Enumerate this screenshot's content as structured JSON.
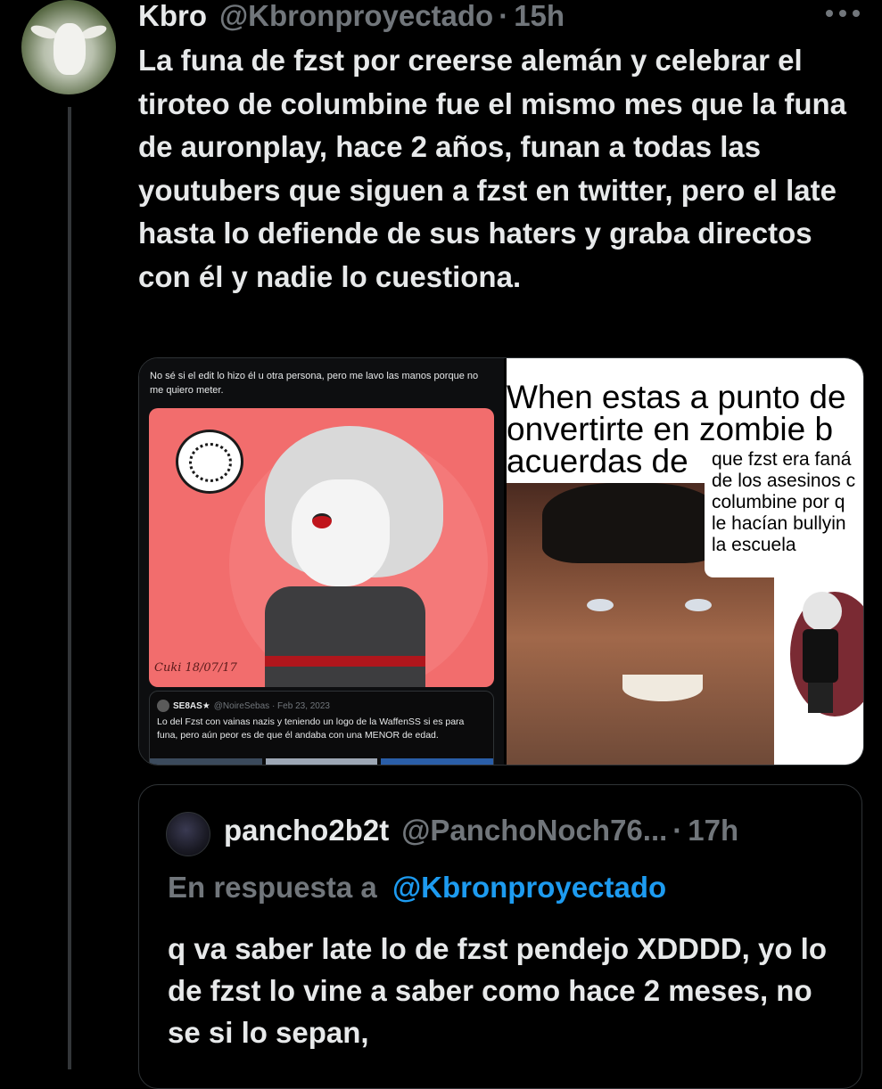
{
  "tweet": {
    "display_name": "Kbro",
    "handle": "@Kbronproyectado",
    "separator": "·",
    "time": "15h",
    "text": "La funa de fzst por creerse alemán y celebrar el tiroteo de columbine fue el mismo mes que la funa de auronplay, hace 2 años, funan a todas las youtubers que siguen a fzst en twitter, pero el late hasta lo defiende de sus haters y graba directos con él y nadie lo cuestiona.",
    "more_icon": "more-horizontal-icon"
  },
  "media": {
    "left": {
      "caption": "No sé si el edit lo hizo él u otra persona, pero me lavo las manos porque no me quiero meter.",
      "signature": "Cuki 18/07/17",
      "quoted": {
        "name": "SE8AS★",
        "handle": "@NoireSebas · Feb 23, 2023",
        "text": "Lo del Fzst con vainas nazis y teniendo un logo de la WaffenSS si es para funa, pero aún peor es de que él andaba con una MENOR de edad."
      }
    },
    "right": {
      "meme_caption": "When estas a punto de\nonvertirte en zombie b\nacuerdas de",
      "meme_subtitle": "que fzst era faná\nde los asesinos c\ncolumbine por q\nle hacían bullyin\nla escuela"
    }
  },
  "reply": {
    "display_name": "pancho2b2t",
    "handle": "@PanchoNoch76...",
    "separator": "·",
    "time": "17h",
    "reply_to_label": "En respuesta a",
    "reply_to_handle": "@Kbronproyectado",
    "text": "q va saber late lo de fzst pendejo XDDDD, yo lo de fzst lo vine a saber como hace 2 meses, no se si lo sepan,"
  },
  "colors": {
    "background": "#000000",
    "text": "#e7e9ea",
    "muted": "#71767b",
    "link": "#1d9bf0",
    "border": "#2f3336"
  }
}
